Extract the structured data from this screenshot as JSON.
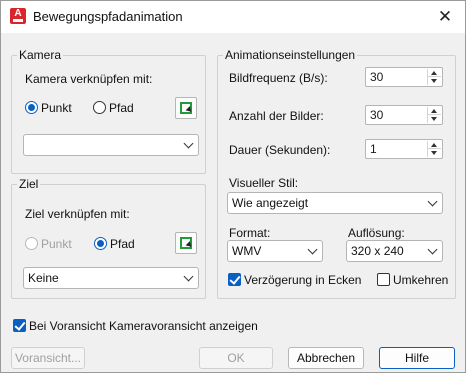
{
  "window": {
    "title": "Bewegungspfadanimation",
    "close": "✕"
  },
  "kamera": {
    "legend": "Kamera",
    "link_label": "Kamera verknüpfen mit:",
    "radio_point": "Punkt",
    "radio_path": "Pfad",
    "selected": "Punkt",
    "dropdown_value": ""
  },
  "ziel": {
    "legend": "Ziel",
    "link_label": "Ziel verknüpfen mit:",
    "radio_point": "Punkt",
    "radio_path": "Pfad",
    "selected": "Pfad",
    "dropdown_value": "Keine"
  },
  "anim": {
    "legend": "Animationseinstellungen",
    "fps_label": "Bildfrequenz (B/s):",
    "fps_value": "30",
    "frames_label": "Anzahl der Bilder:",
    "frames_value": "30",
    "duration_label": "Dauer (Sekunden):",
    "duration_value": "1",
    "style_label": "Visueller Stil:",
    "style_value": "Wie angezeigt",
    "format_label": "Format:",
    "format_value": "WMV",
    "resolution_label": "Auflösung:",
    "resolution_value": "320 x 240",
    "corner_delay_label": "Verzögerung in Ecken",
    "corner_delay_checked": true,
    "reverse_label": "Umkehren",
    "reverse_checked": false
  },
  "preview_checkbox_label": "Bei Voransicht Kameravoransicht anzeigen",
  "preview_checkbox_checked": true,
  "buttons": {
    "preview": "Voransicht...",
    "ok": "OK",
    "cancel": "Abbrechen",
    "help": "Hilfe"
  },
  "icons": {
    "app": "autocad-app-icon",
    "close": "close-icon",
    "pick": "select-object-icon"
  },
  "colors": {
    "accent": "#0a5fc4",
    "app_icon": "#d9262c"
  }
}
